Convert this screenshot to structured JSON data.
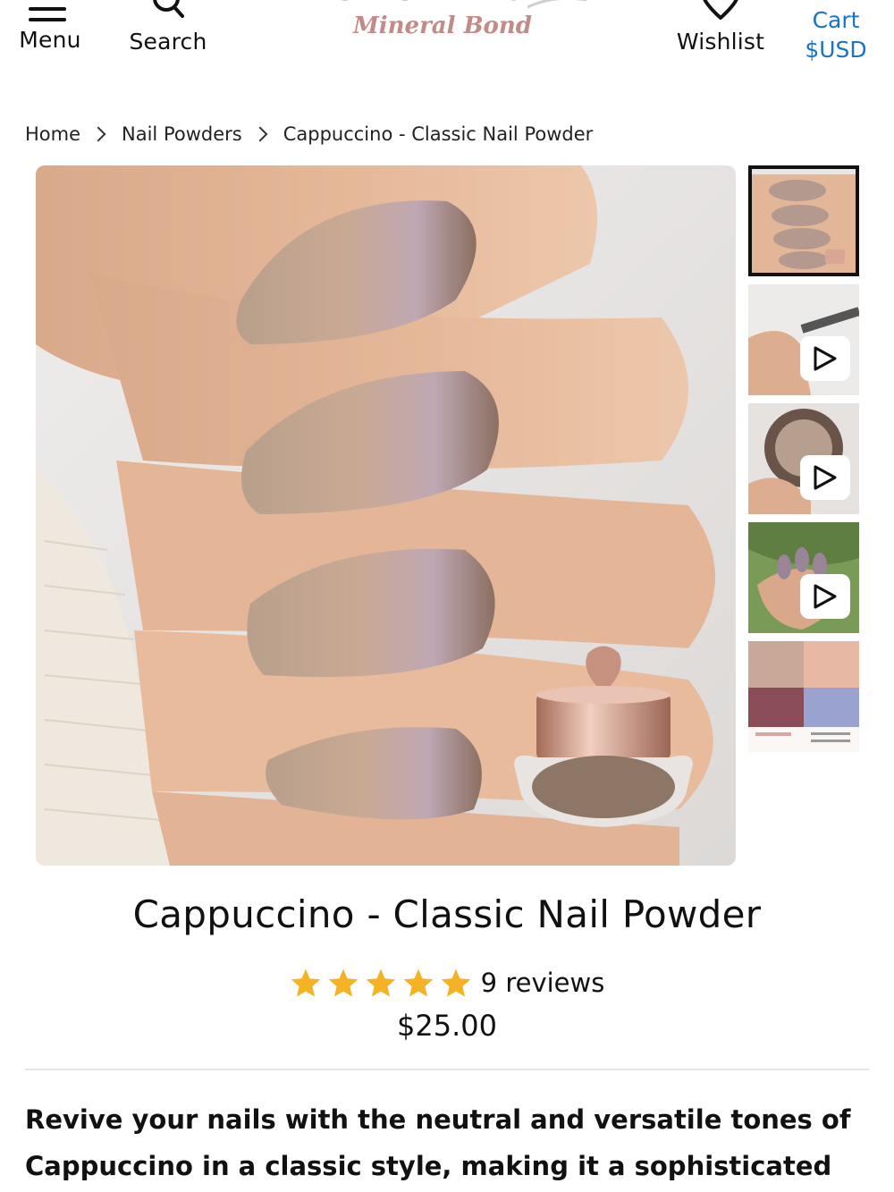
{
  "header": {
    "menu_label": "Menu",
    "search_label": "Search",
    "logo_top_text": "SISTACO",
    "logo_script_text": "Mineral Bond",
    "wishlist_label": "Wishlist",
    "cart_label": "Cart",
    "currency_label": "$USD"
  },
  "breadcrumb": {
    "items": [
      "Home",
      "Nail Powders",
      "Cappuccino - Classic Nail Powder"
    ]
  },
  "gallery": {
    "main_image_name": "cappuccino-nails-with-powder-jar",
    "thumbnails": [
      {
        "name": "nails-photo",
        "has_play": false,
        "selected": true
      },
      {
        "name": "application-video",
        "has_play": true,
        "selected": false
      },
      {
        "name": "jar-video",
        "has_play": true,
        "selected": false
      },
      {
        "name": "hand-outdoor-video",
        "has_play": true,
        "selected": false
      },
      {
        "name": "color-collage",
        "has_play": false,
        "selected": false
      }
    ]
  },
  "product": {
    "title": "Cappuccino - Classic Nail Powder",
    "rating": 5,
    "reviews_label": "9 reviews",
    "price": "$25.00",
    "description": "Revive your nails with the neutral and versatile tones of Cappuccino in a classic style, making it a sophisticated"
  },
  "colors": {
    "accent_link": "#1a73c7",
    "star": "#f5b225",
    "logo_script": "#c38a88"
  }
}
